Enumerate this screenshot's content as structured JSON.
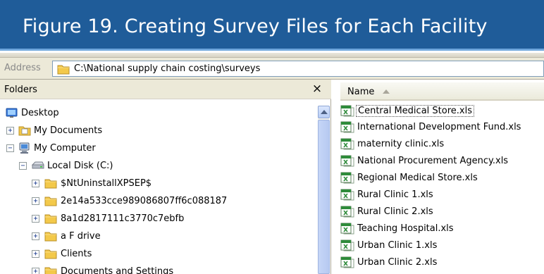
{
  "figure": {
    "title": "Figure 19. Creating Survey Files for Each Facility"
  },
  "address_bar": {
    "label": "Address",
    "path": "C:\\National supply chain costing\\surveys"
  },
  "folders_pane": {
    "title": "Folders",
    "close_symbol": "×",
    "tree": [
      {
        "label": "Desktop",
        "icon": "desktop-icon",
        "expander": ""
      },
      {
        "label": "My Documents",
        "icon": "documents-folder-icon",
        "expander": "+"
      },
      {
        "label": "My Computer",
        "icon": "computer-icon",
        "expander": "−"
      },
      {
        "label": "Local Disk (C:)",
        "icon": "drive-icon",
        "expander": "−"
      },
      {
        "label": "$NtUninstallXPSEP$",
        "icon": "folder-icon",
        "expander": "+"
      },
      {
        "label": "2e14a533cce989086807ff6c088187",
        "icon": "folder-icon",
        "expander": "+"
      },
      {
        "label": "8a1d2817111c3770c7ebfb",
        "icon": "folder-icon",
        "expander": "+"
      },
      {
        "label": "a F drive",
        "icon": "folder-icon",
        "expander": "+"
      },
      {
        "label": "Clients",
        "icon": "folder-icon",
        "expander": "+"
      },
      {
        "label": "Documents and Settings",
        "icon": "folder-icon",
        "expander": "+"
      }
    ]
  },
  "files_pane": {
    "column_header": "Name",
    "files": [
      {
        "name": "Central Medical Store.xls",
        "icon": "excel-file-icon"
      },
      {
        "name": "International Development Fund.xls",
        "icon": "excel-file-icon"
      },
      {
        "name": "maternity clinic.xls",
        "icon": "excel-file-icon"
      },
      {
        "name": "National Procurement Agency.xls",
        "icon": "excel-file-icon"
      },
      {
        "name": "Regional Medical Store.xls",
        "icon": "excel-file-icon"
      },
      {
        "name": "Rural Clinic 1.xls",
        "icon": "excel-file-icon"
      },
      {
        "name": "Rural Clinic 2.xls",
        "icon": "excel-file-icon"
      },
      {
        "name": "Teaching Hospital.xls",
        "icon": "excel-file-icon"
      },
      {
        "name": "Urban Clinic 1.xls",
        "icon": "excel-file-icon"
      },
      {
        "name": "Urban Clinic 2.xls",
        "icon": "excel-file-icon"
      }
    ]
  },
  "colors": {
    "banner": "#1f5c99",
    "banner_stripe": "#6fa7dc",
    "folder": "#f3c94a",
    "excel": "#2e8b3a"
  }
}
